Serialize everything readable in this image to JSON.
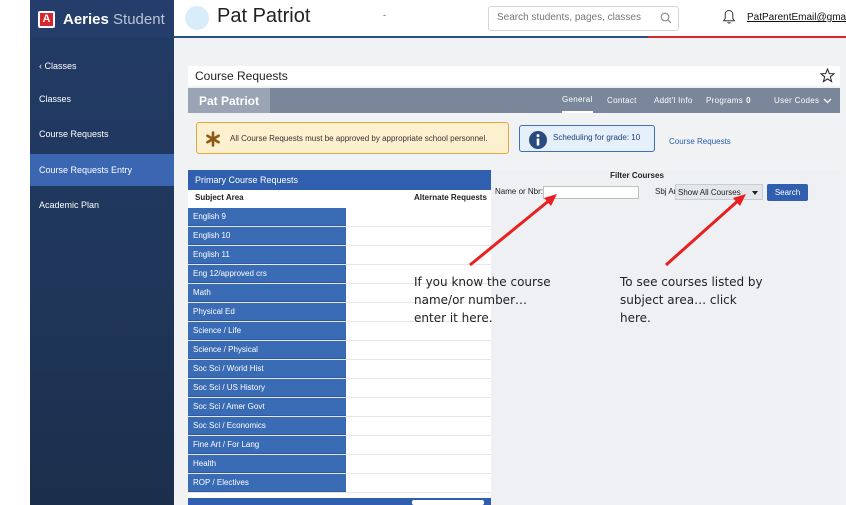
{
  "app": {
    "brand_bold": "Aeries",
    "brand_light": " Student",
    "logo_letter": "A"
  },
  "header": {
    "student_name": "Pat Patriot",
    "dot": "-",
    "search_placeholder": "Search students, pages, classes",
    "user_email": "PatParentEmail@gmail.c"
  },
  "sidebar": {
    "back_label": "‹ Classes",
    "items": [
      {
        "label": "Classes"
      },
      {
        "label": "Course Requests"
      },
      {
        "label": "Course Requests Entry",
        "active": true
      },
      {
        "label": "Academic Plan"
      }
    ]
  },
  "page": {
    "title": "Course Requests",
    "student_tab": "Pat Patriot",
    "tabs": [
      {
        "label": "General",
        "active": true
      },
      {
        "label": "Contact"
      },
      {
        "label": "Addt'l Info"
      },
      {
        "label": "Programs",
        "count": "0"
      },
      {
        "label": "User Codes"
      }
    ]
  },
  "notices": {
    "warning": "All Course Requests must be approved by appropriate school personnel.",
    "info": "Scheduling for grade: 10",
    "info_link": "Course Requests"
  },
  "requests_table": {
    "header": "Primary Course Requests",
    "col_subject": "Subject Area",
    "col_alternate": "Alternate Requests",
    "rows": [
      "English 9",
      "English 10",
      "English 11",
      "Eng 12/approved crs",
      "Math",
      "Physical Ed",
      "Science / Life",
      "Science / Physical",
      "Soc Sci / World Hist",
      "Soc Sci / US History",
      "Soc Sci / Amer Govt",
      "Soc Sci / Economics",
      "Fine Art / For Lang",
      "Health",
      "ROP / Electives"
    ]
  },
  "filter": {
    "title": "Filter Courses",
    "name_label": "Name or Nbr:",
    "name_value": "",
    "subject_label": "Sbj Area:",
    "subject_selected": "Show All Courses",
    "search_button": "Search"
  },
  "annotations": {
    "left": "If you know the course\nname/or number…\nenter it here.",
    "right": "To see courses listed by\nsubject area… click\nhere."
  },
  "colors": {
    "brand_navy": "#243d6b",
    "accent_blue": "#2f5fae",
    "arrow_red": "#e8201f",
    "warning_bg": "#fdf0cf"
  }
}
